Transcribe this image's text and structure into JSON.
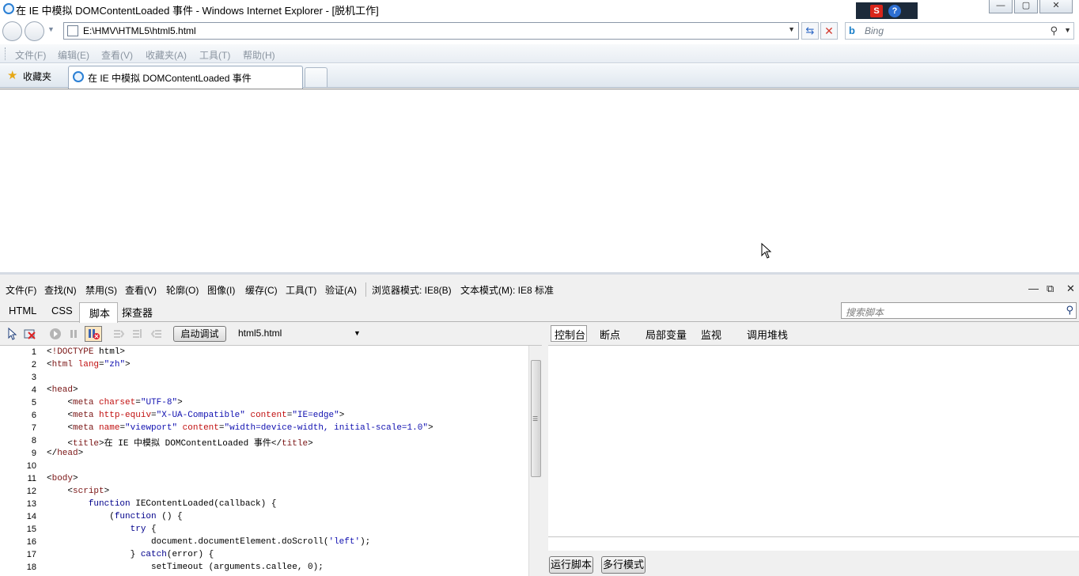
{
  "window": {
    "title": "在 IE 中模拟 DOMContentLoaded 事件 - Windows Internet Explorer - [脱机工作]"
  },
  "address": {
    "url": "E:\\HMV\\HTML5\\html5.html",
    "search_placeholder": "Bing"
  },
  "menubar": {
    "items": [
      "文件(F)",
      "编辑(E)",
      "查看(V)",
      "收藏夹(A)",
      "工具(T)",
      "帮助(H)"
    ]
  },
  "favorites": {
    "label": "收藏夹",
    "active_tab": "在 IE 中模拟 DOMContentLoaded 事件"
  },
  "devtools": {
    "menu": [
      "文件(F)",
      "查找(N)",
      "禁用(S)",
      "查看(V)",
      "轮廓(O)",
      "图像(I)",
      "缓存(C)",
      "工具(T)",
      "验证(A)",
      "浏览器模式: IE8(B)",
      "文本模式(M): IE8 标准"
    ],
    "tabs": [
      "HTML",
      "CSS",
      "脚本",
      "探查器"
    ],
    "active_tab": "脚本",
    "search_placeholder": "搜索脚本",
    "start_debug": "启动调试",
    "file": "html5.html",
    "right_tabs": [
      "控制台",
      "断点",
      "局部变量",
      "监视",
      "调用堆栈"
    ],
    "run_script": "运行脚本",
    "multiline": "多行模式",
    "code_lines": [
      {
        "n": "1",
        "t": "<!DOCTYPE html>"
      },
      {
        "n": "2",
        "t": "<html lang=\"zh\">"
      },
      {
        "n": "3",
        "t": ""
      },
      {
        "n": "4",
        "t": "<head>"
      },
      {
        "n": "5",
        "t": "    <meta charset=\"UTF-8\">"
      },
      {
        "n": "6",
        "t": "    <meta http-equiv=\"X-UA-Compatible\" content=\"IE=edge\">"
      },
      {
        "n": "7",
        "t": "    <meta name=\"viewport\" content=\"width=device-width, initial-scale=1.0\">"
      },
      {
        "n": "8",
        "t": "    <title>在 IE 中模拟 DOMContentLoaded 事件</title>"
      },
      {
        "n": "9",
        "t": "</head>"
      },
      {
        "n": "10",
        "t": ""
      },
      {
        "n": "11",
        "t": "<body>"
      },
      {
        "n": "12",
        "t": "    <script>"
      },
      {
        "n": "13",
        "t": "        function IEContentLoaded(callback) {"
      },
      {
        "n": "14",
        "t": "            (function () {"
      },
      {
        "n": "15",
        "t": "                try {"
      },
      {
        "n": "16",
        "t": "                    document.documentElement.doScroll('left');"
      },
      {
        "n": "17",
        "t": "                } catch(error) {"
      },
      {
        "n": "18",
        "t": "                    setTimeout (arguments.callee, 0);"
      }
    ]
  }
}
